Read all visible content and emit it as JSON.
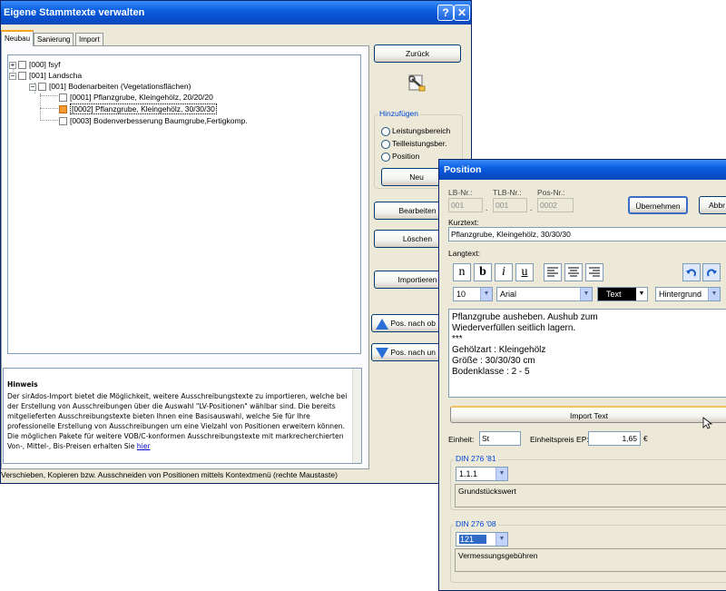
{
  "main_window": {
    "title": "Eigene Stammtexte verwalten",
    "help_btn": "?",
    "close_btn": "✕"
  },
  "tabs": [
    "Neubau",
    "Sanierung",
    "Import"
  ],
  "tree": {
    "nodes": [
      {
        "exp": "+",
        "label": "[000] fsyf"
      },
      {
        "exp": "−",
        "label": "[001] Landscha"
      },
      {
        "exp": "−",
        "label": "[001] Bodenarbeiten (Vegetationsflächen)"
      },
      {
        "label": "[0001] Pflanzgrube, Kleingehölz, 20/20/20"
      },
      {
        "label": "[0002] Pflanzgrube, Kleingehölz, 30/30/30"
      },
      {
        "label": "[0003] Bodenverbesserung Baumgrube,Fertigkomp."
      }
    ]
  },
  "side_buttons": {
    "zurueck": "Zurück",
    "bearbeiten": "Bearbeiten",
    "loeschen": "Löschen",
    "importieren": "Importieren",
    "neu": "Neu",
    "pos_nach_oben": "Pos. nach ob",
    "pos_nach_unten": "Pos. nach un"
  },
  "hinzufuegen": {
    "title": "Hinzufügen",
    "options": [
      "Leistungsbereich",
      "Teilleistungsber.",
      "Position"
    ]
  },
  "hinweis": {
    "heading": "Hinweis",
    "text": "Der sirAdos-Import bietet die Möglichkeit, weitere Ausschreibungstexte zu importieren, welche bei der Erstellung von Ausschreibungen über die Auswahl \"LV-Positionen\" wählbar sind. Die bereits mitgelieferten Ausschreibungstexte bieten Ihnen eine Basisauswahl, welche Sie für Ihre professionelle Erstellung von Ausschreibungen um eine Vielzahl von Positionen erweitern können. Die möglichen Pakete für weitere VOB/C-konformen Ausschreibungstexte mit markrecherchierten Von-, Mittel-, Bis-Preisen erhalten Sie",
    "link": "hier"
  },
  "statusline": "Verschieben, Kopieren bzw. Ausschneiden von Positionen mittels Kontextmenü (rechte Maustaste)",
  "position_dialog": {
    "title": "Position",
    "lb_label": "LB-Nr.:",
    "tlb_label": "TLB-Nr.:",
    "pos_label": "Pos-Nr.:",
    "lb_value": "001",
    "tlb_value": "001",
    "pos_value": "0002",
    "sep": ".",
    "uebernehmen": "Übernehmen",
    "abbrechen": "Abbr",
    "kurztext_label": "Kurztext:",
    "kurztext_value": "Pflanzgrube, Kleingehölz, 30/30/30",
    "langtext_label": "Langtext:",
    "fmt": {
      "n": "n",
      "b": "b",
      "i": "i",
      "u": "u"
    },
    "font_size": "10",
    "font_name": "Arial",
    "text_color": "Text",
    "bg_color": "Hintergrund",
    "langtext_value": "Pflanzgrube ausheben. Aushub zum\nWiederverfüllen seitlich lagern.\n***\nGehölzart : Kleingehölz\nGröße : 30/30/30 cm\nBodenklasse : 2 - 5",
    "import_text": "Import Text",
    "einheit_label": "Einheit:",
    "einheit_value": "St",
    "ep_label": "Einheitspreis EP:",
    "ep_value": "1,65",
    "currency": "€",
    "din81_title": "DIN 276 '81",
    "din81_value": "1.1.1",
    "din81_text": "Grundstückswert",
    "din08_title": "DIN 276 '08",
    "din08_value": "121",
    "din08_text": "Vermessungsgebühren"
  }
}
